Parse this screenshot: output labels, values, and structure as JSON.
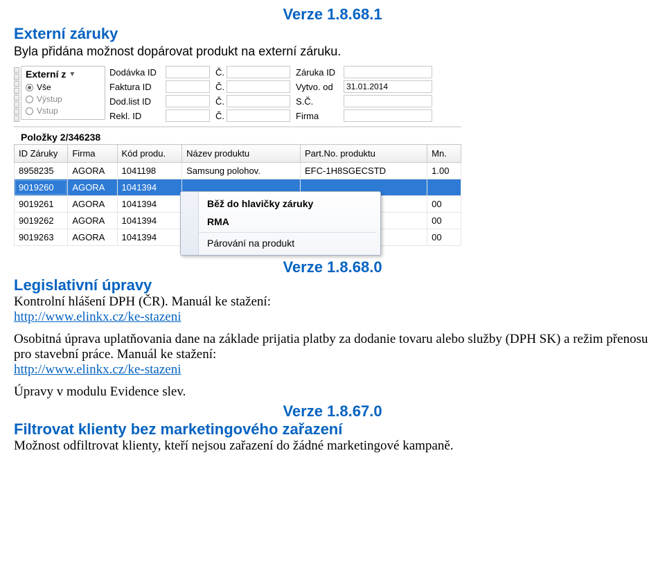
{
  "version_top": "Verze 1.8.68.1",
  "section1": {
    "title": "Externí záruky",
    "desc": "Byla přidána možnost dopárovat produkt na externí záruku."
  },
  "app": {
    "type_box": {
      "title": "Externí z",
      "opts": [
        "Vše",
        "Výstup",
        "Vstup"
      ],
      "selected_index": 0
    },
    "filters_col1": [
      {
        "label": "Dodávka ID"
      },
      {
        "label": "Faktura ID"
      },
      {
        "label": "Dod.list ID"
      },
      {
        "label": "Rekl. ID"
      }
    ],
    "filters_col2": [
      {
        "label": "Č."
      },
      {
        "label": "Č."
      },
      {
        "label": "Č."
      },
      {
        "label": "Č."
      }
    ],
    "filters_col3": [
      {
        "label": "Záruka ID",
        "value": ""
      },
      {
        "label": "Vytvo. od",
        "value": "31.01.2014"
      },
      {
        "label": "S.Č.",
        "value": ""
      },
      {
        "label": "Firma",
        "value": ""
      }
    ],
    "items_bar": "Položky  2/346238",
    "grid": {
      "headers": [
        "ID Záruky",
        "Firma",
        "Kód produ.",
        "Název produktu",
        "Part.No. produktu",
        "Mn."
      ],
      "widths": [
        76,
        70,
        92,
        168,
        180,
        48
      ],
      "rows": [
        {
          "cells": [
            "8958235",
            "AGORA",
            "1041198",
            "Samsung polohov.",
            "EFC-1H8SGECSTD",
            "1.00"
          ]
        },
        {
          "cells": [
            "9019260",
            "AGORA",
            "1041394",
            "",
            "",
            ""
          ],
          "selected": true
        },
        {
          "cells": [
            "9019261",
            "AGORA",
            "1041394",
            "",
            "",
            "00"
          ]
        },
        {
          "cells": [
            "9019262",
            "AGORA",
            "1041394",
            "",
            "",
            "00"
          ]
        },
        {
          "cells": [
            "9019263",
            "AGORA",
            "1041394",
            "",
            "",
            "00"
          ]
        }
      ]
    },
    "context_menu": [
      {
        "label": "Běž do hlavičky záruky",
        "bold": true
      },
      {
        "label": "RMA",
        "bold": true
      },
      {
        "sep": true
      },
      {
        "label": "Párování na produkt"
      }
    ]
  },
  "version_mid": "Verze 1.8.68.0",
  "section2": {
    "title": "Legislativní úpravy",
    "line1_a": "Kontrolní hlášení DPH (ČR). ",
    "line1_b": "Manuál ke stažení:",
    "link": "http://www.elinkx.cz/ke-stazeni",
    "para2_a": "Osobitná úprava uplatňovania dane na základe prijatia platby za dodanie tovaru alebo služby (DPH SK) a režim přenosu pro stavební práce. ",
    "para2_b": "Manuál ke stažení:",
    "line3": "Úpravy v modulu Evidence slev."
  },
  "version_bot": "Verze 1.8.67.0",
  "section3": {
    "title": "Filtrovat klienty bez marketingového zařazení",
    "desc": "Možnost odfiltrovat klienty, kteří nejsou zařazení do žádné marketingové kampaně."
  }
}
